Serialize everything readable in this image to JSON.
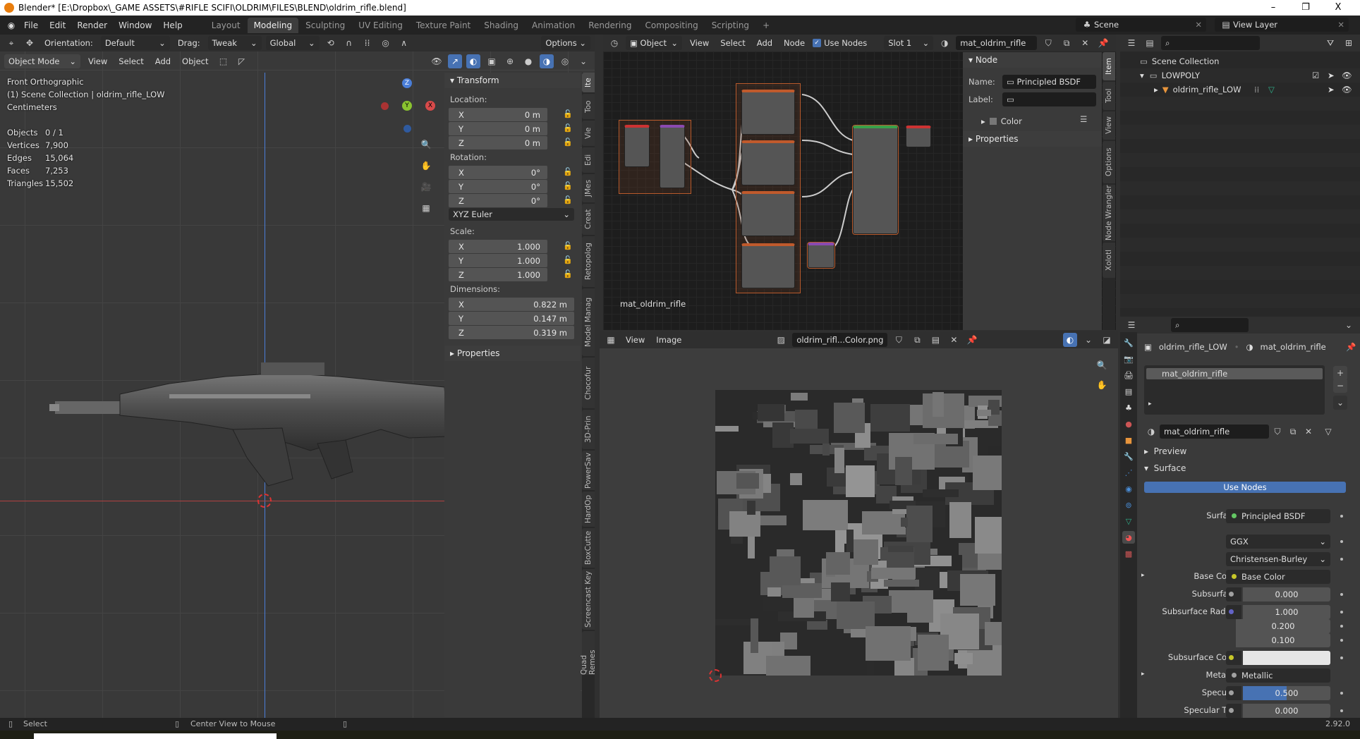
{
  "window": {
    "title": "Blender* [E:\\Dropbox\\_GAME ASSETS\\#RIFLE SCIFI\\OLDRIM\\FILES\\BLEND\\oldrim_rifle.blend]",
    "minimize": "–",
    "maximize": "❐",
    "close": "X"
  },
  "menu": [
    "File",
    "Edit",
    "Render",
    "Window",
    "Help"
  ],
  "workspaces": [
    "Layout",
    "Modeling",
    "Sculpting",
    "UV Editing",
    "Texture Paint",
    "Shading",
    "Animation",
    "Rendering",
    "Compositing",
    "Scripting",
    "+"
  ],
  "active_workspace": "Modeling",
  "scene": "Scene",
  "view_layer": "View Layer",
  "viewport": {
    "orientation_label": "Orientation:",
    "orientation": "Default",
    "drag_label": "Drag:",
    "drag": "Tweak",
    "transform_orientation": "Global",
    "options": "Options",
    "mode": "Object Mode",
    "menus": [
      "View",
      "Select",
      "Add",
      "Object"
    ],
    "overlay": [
      "Front Orthographic",
      "(1) Scene Collection | oldrim_rifle_LOW",
      "Centimeters"
    ],
    "stats": [
      {
        "k": "Objects",
        "v": "0 / 1"
      },
      {
        "k": "Vertices",
        "v": "7,900"
      },
      {
        "k": "Edges",
        "v": "15,064"
      },
      {
        "k": "Faces",
        "v": "7,253"
      },
      {
        "k": "Triangles",
        "v": "15,502"
      }
    ],
    "gizmo": {
      "z": "Z",
      "y": "Y",
      "x": "X"
    }
  },
  "npanel": {
    "transform": "Transform",
    "location": "Location:",
    "rotation": "Rotation:",
    "scale": "Scale:",
    "dimensions": "Dimensions:",
    "properties": "Properties",
    "loc": [
      {
        "a": "X",
        "v": "0 m"
      },
      {
        "a": "Y",
        "v": "0 m"
      },
      {
        "a": "Z",
        "v": "0 m"
      }
    ],
    "rot": [
      {
        "a": "X",
        "v": "0°"
      },
      {
        "a": "Y",
        "v": "0°"
      },
      {
        "a": "Z",
        "v": "0°"
      }
    ],
    "rot_mode": "XYZ Euler",
    "scl": [
      {
        "a": "X",
        "v": "1.000"
      },
      {
        "a": "Y",
        "v": "1.000"
      },
      {
        "a": "Z",
        "v": "1.000"
      }
    ],
    "dim": [
      {
        "a": "X",
        "v": "0.822 m"
      },
      {
        "a": "Y",
        "v": "0.147 m"
      },
      {
        "a": "Z",
        "v": "0.319 m"
      }
    ],
    "tabs": [
      "Ite",
      "Too",
      "Vie",
      "Edi",
      "JMes",
      "Creat",
      "Retopolog",
      "Model Manag",
      "Chocofur",
      "3D-Prin",
      "PowerSav",
      "HardOp",
      "BoxCutte",
      "Screencast Key",
      "Quad Remes"
    ]
  },
  "node_editor": {
    "object": "Object",
    "menus": [
      "View",
      "Select",
      "Add",
      "Node"
    ],
    "use_nodes": "Use Nodes",
    "slot": "Slot 1",
    "material": "mat_oldrim_rifle",
    "canvas_label": "mat_oldrim_rifle",
    "panel": {
      "node": "Node",
      "name_label": "Name:",
      "name": "Principled BSDF",
      "label_label": "Label:",
      "color": "Color",
      "properties": "Properties"
    },
    "tabs": [
      "Item",
      "Tool",
      "View",
      "Options",
      "Node Wrangler",
      "Xolotl"
    ]
  },
  "image_editor": {
    "menus": [
      "View",
      "Image"
    ],
    "image": "oldrim_rifl...Color.png"
  },
  "outliner": {
    "root": "Scene Collection",
    "collection": "LOWPOLY",
    "object": "oldrim_rifle_LOW"
  },
  "properties": {
    "object": "oldrim_rifle_LOW",
    "material": "mat_oldrim_rifle",
    "slot": "mat_oldrim_rifle",
    "datablock": "mat_oldrim_rifle",
    "preview": "Preview",
    "surface_panel": "Surface",
    "use_nodes": "Use Nodes",
    "rows": [
      {
        "label": "Surface",
        "type": "link",
        "value": "Principled BSDF",
        "dot": "#63c763"
      },
      {
        "label": "",
        "type": "enum",
        "value": "GGX"
      },
      {
        "label": "",
        "type": "enum",
        "value": "Christensen-Burley"
      },
      {
        "label": "Base Color",
        "type": "link",
        "value": "Base Color",
        "dot": "#c7c729",
        "expand": true
      },
      {
        "label": "Subsurface",
        "type": "num",
        "value": "0.000",
        "dot": "#a1a1a1"
      },
      {
        "label": "Subsurface Radius",
        "type": "num",
        "value": "1.000",
        "dot": "#6363c7"
      },
      {
        "label": "",
        "type": "num",
        "value": "0.200"
      },
      {
        "label": "",
        "type": "num",
        "value": "0.100"
      },
      {
        "label": "Subsurface Color",
        "type": "color",
        "value": "",
        "dot": "#c7c729"
      },
      {
        "label": "Metallic",
        "type": "link",
        "value": "Metallic",
        "dot": "#a1a1a1",
        "expand": true
      },
      {
        "label": "Specular",
        "type": "num",
        "value": "0.500",
        "dot": "#a1a1a1",
        "fill": 0.5
      },
      {
        "label": "Specular Tint",
        "type": "num",
        "value": "0.000",
        "dot": "#a1a1a1"
      }
    ]
  },
  "status": {
    "select": "Select",
    "center": "Center View to Mouse",
    "version": "2.92.0"
  },
  "colors": {
    "accent": "#4772b3",
    "x_axis": "#d84a4a",
    "y_axis": "#8ac330",
    "z_axis": "#4a7ed8",
    "frame": "#b85a2c"
  }
}
